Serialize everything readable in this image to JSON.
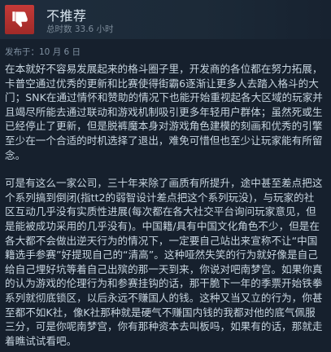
{
  "review": {
    "verdict": "不推荐",
    "hours": "总时数 33.6 小时",
    "posted": "发布于：10 月 6 日",
    "icon": "thumbs-down-icon",
    "colors": {
      "thumb_bg": "#b3302e",
      "header_bg": "#1e2d3d",
      "body_bg": "#16202d",
      "text": "#c6d4df",
      "muted": "#7e8d9b"
    },
    "paragraphs": [
      "在本就好不容易发展起来的格斗圈子里，开发商的各位都在努力拓展，卡普空通过优秀的更新和比赛使得街霸6逐渐让更多人去踏入格斗的大门；SNK在通过情怀和赞助的情况下也能开始重视起各大区域的玩家并且竭尽所能去通过联动和游戏机制吸引更多年轻用户群体；虽然死或生已经停止了更新，但是脱裤魔本身对游戏角色建模的刻画和优秀的引擎至少在一个合适的时机选择了退出，难免可惜但也至少让玩家能有所留念。",
      "可是有这么一家公司，三十年来除了画质有所提升，途中甚至差点把这个系列搞到倒闭(指tt2的弱智设计差点把这个系列玩没)，与玩家的社区互动几乎没有实质性进展(每次都在各大社交平台询问玩家意见，但是能被成功采用的几乎没有)。中国籍/具有中国文化角色不少，但是在各大都不会做出逆天行为的情况下，一定要自己站出来宣称不让“中国籍选手参赛”好提现自己的“清高”。这种哑然失笑的行为就好像是自己给自己埋好坑等着自己出殡的那一天到来，你说对吧南梦宫。如果你真的认为游戏的伦理行为和参赛挂钩的话，那干脆下一年的季票开始铁拳系列就彻底锁区，以后永远不赚国人的钱。这种又当又立的行为，你甚至都不如K社，像K社那种就是硬气不赚国内钱的我都对他的底气佩服三分，可是你呢南梦宫，你有那种资本去叫板吗，如果有的话，那就走着瞧试试看吧。"
    ]
  }
}
